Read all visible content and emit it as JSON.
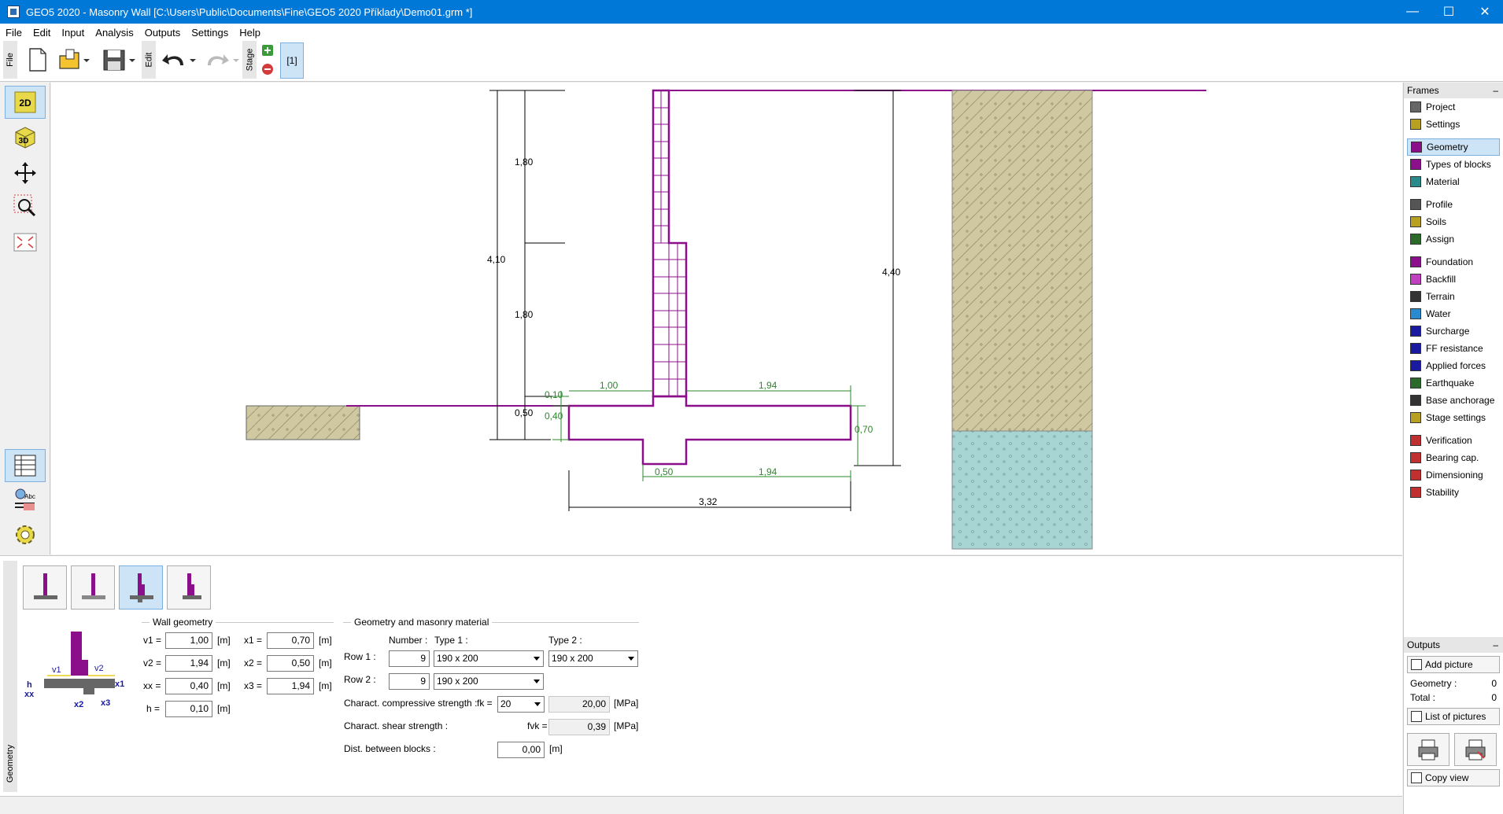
{
  "window": {
    "title": "GEO5 2020 - Masonry Wall [C:\\Users\\Public\\Documents\\Fine\\GEO5 2020 Příklady\\Demo01.grm *]"
  },
  "menu": [
    "File",
    "Edit",
    "Input",
    "Analysis",
    "Outputs",
    "Settings",
    "Help"
  ],
  "toolbar": {
    "file_tab": "File",
    "edit_tab": "Edit",
    "stage_tab": "Stage",
    "stage_label": "[1]"
  },
  "left_tools": {
    "view_2d": "2D",
    "view_3d": "3D"
  },
  "drawing": {
    "dims": {
      "total_height_left": "4,10",
      "upper_segment": "1,80",
      "middle_segment": "1,80",
      "footing_height_left": "0,50",
      "step": "0,10",
      "footing_thickness": "0,40",
      "left_offset": "1,00",
      "right_offset": "1,94",
      "right_height": "0,70",
      "key_width": "0,50",
      "key_right": "1,94",
      "total_width": "3,32",
      "total_height_right": "4,40"
    }
  },
  "frames": {
    "header": "Frames",
    "groups": [
      [
        {
          "label": "Project",
          "icon": "project-icon"
        },
        {
          "label": "Settings",
          "icon": "settings-gear-icon"
        }
      ],
      [
        {
          "label": "Geometry",
          "icon": "geometry-icon",
          "active": true
        },
        {
          "label": "Types of blocks",
          "icon": "blocks-icon"
        },
        {
          "label": "Material",
          "icon": "material-icon"
        }
      ],
      [
        {
          "label": "Profile",
          "icon": "profile-icon"
        },
        {
          "label": "Soils",
          "icon": "soils-icon"
        },
        {
          "label": "Assign",
          "icon": "assign-icon"
        }
      ],
      [
        {
          "label": "Foundation",
          "icon": "foundation-icon"
        },
        {
          "label": "Backfill",
          "icon": "backfill-icon"
        },
        {
          "label": "Terrain",
          "icon": "terrain-icon"
        },
        {
          "label": "Water",
          "icon": "water-icon"
        },
        {
          "label": "Surcharge",
          "icon": "surcharge-icon"
        },
        {
          "label": "FF resistance",
          "icon": "ff-resistance-icon"
        },
        {
          "label": "Applied forces",
          "icon": "applied-forces-icon"
        },
        {
          "label": "Earthquake",
          "icon": "earthquake-icon"
        },
        {
          "label": "Base anchorage",
          "icon": "base-anchorage-icon"
        },
        {
          "label": "Stage settings",
          "icon": "stage-settings-icon"
        }
      ],
      [
        {
          "label": "Verification",
          "icon": "verification-icon"
        },
        {
          "label": "Bearing cap.",
          "icon": "bearing-cap-icon"
        },
        {
          "label": "Dimensioning",
          "icon": "dimensioning-icon"
        },
        {
          "label": "Stability",
          "icon": "stability-icon"
        }
      ]
    ]
  },
  "outputs": {
    "header": "Outputs",
    "add_picture": "Add picture",
    "geometry_label": "Geometry :",
    "geometry_count": "0",
    "total_label": "Total :",
    "total_count": "0",
    "list_pictures": "List of pictures",
    "copy_view": "Copy view"
  },
  "bottom": {
    "tab_label": "Geometry",
    "wall_geometry": {
      "title": "Wall geometry",
      "v1_label": "v1 =",
      "v1": "1,00",
      "v2_label": "v2 =",
      "v2": "1,94",
      "xx_label": "xx =",
      "xx": "0,40",
      "h_label": "h =",
      "h": "0,10",
      "x1_label": "x1 =",
      "x1": "0,70",
      "x2_label": "x2 =",
      "x2": "0,50",
      "x3_label": "x3 =",
      "x3": "1,94",
      "unit": "[m]"
    },
    "masonry": {
      "title": "Geometry and masonry material",
      "number_header": "Number :",
      "type1_header": "Type 1 :",
      "type2_header": "Type 2 :",
      "row1_label": "Row 1 :",
      "row1_number": "9",
      "row1_type1": "190 x 200",
      "row1_type2": "190 x 200",
      "row2_label": "Row 2 :",
      "row2_number": "9",
      "row2_type1": "190 x 200",
      "compressive_label": "Charact. compressive strength :",
      "fk_label": "fk =",
      "fk_select": "20",
      "fk_value": "20,00",
      "shear_label": "Charact. shear strength :",
      "fvk_label": "fvk =",
      "fvk_value": "0,39",
      "mpa": "[MPa]",
      "dist_label": "Dist. between blocks :",
      "dist_value": "0,00",
      "dist_unit": "[m]"
    },
    "scheme_labels": {
      "v1": "v1",
      "v2": "v2",
      "h": "h",
      "xx": "xx",
      "x1": "x1",
      "x2": "x2",
      "x3": "x3"
    }
  },
  "colors": {
    "wall": "#8b0f8b",
    "dim": "#2a8a2a",
    "soil1": "#cfc8a0",
    "soil2": "#a8d4d4",
    "accent": "#0078d7"
  }
}
